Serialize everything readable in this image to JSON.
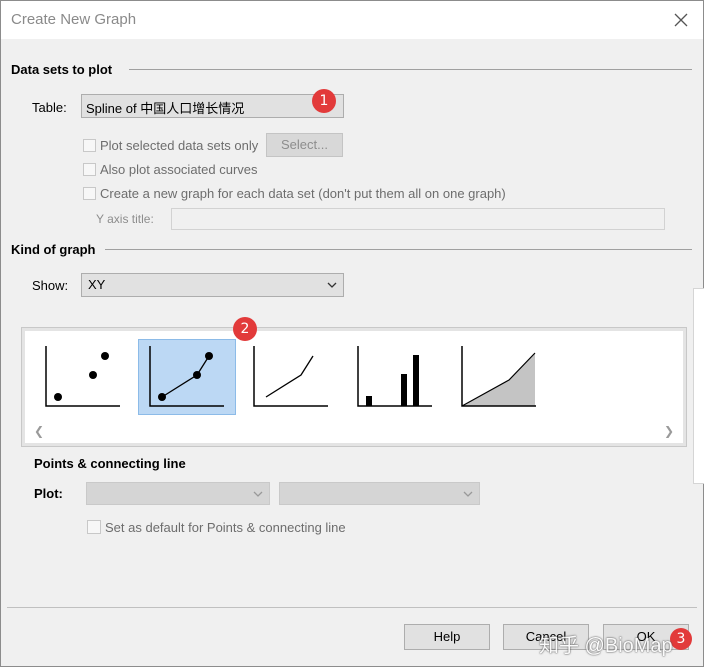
{
  "window": {
    "title": "Create New Graph"
  },
  "datasets": {
    "heading": "Data sets to plot",
    "table_label": "Table:",
    "table_value": "Spline of 中国人口增长情况",
    "badge1": "1",
    "plot_selected_label": "Plot selected data sets only",
    "select_button": "Select...",
    "also_plot_label": "Also plot associated curves",
    "new_graph_label": "Create a new graph for each data set (don't put them all on one graph)",
    "yaxis_title_label": "Y axis title:"
  },
  "kind": {
    "heading": "Kind of graph",
    "show_label": "Show:",
    "show_value": "XY",
    "badge2": "2",
    "thumbnails": [
      "points-only",
      "points-and-connecting-line",
      "line-only",
      "spikes",
      "area-fill"
    ],
    "selected_thumbnail": "points-and-connecting-line"
  },
  "options": {
    "subheading": "Points & connecting line",
    "plot_label": "Plot:",
    "default_label": "Set as default for Points & connecting line"
  },
  "footer": {
    "help": "Help",
    "cancel": "Cancel",
    "ok": "OK",
    "badge3": "3",
    "watermark": "知乎 @BioMap"
  },
  "colors": {
    "badge": "#e23a3a",
    "selection": "#bcd8f4"
  }
}
